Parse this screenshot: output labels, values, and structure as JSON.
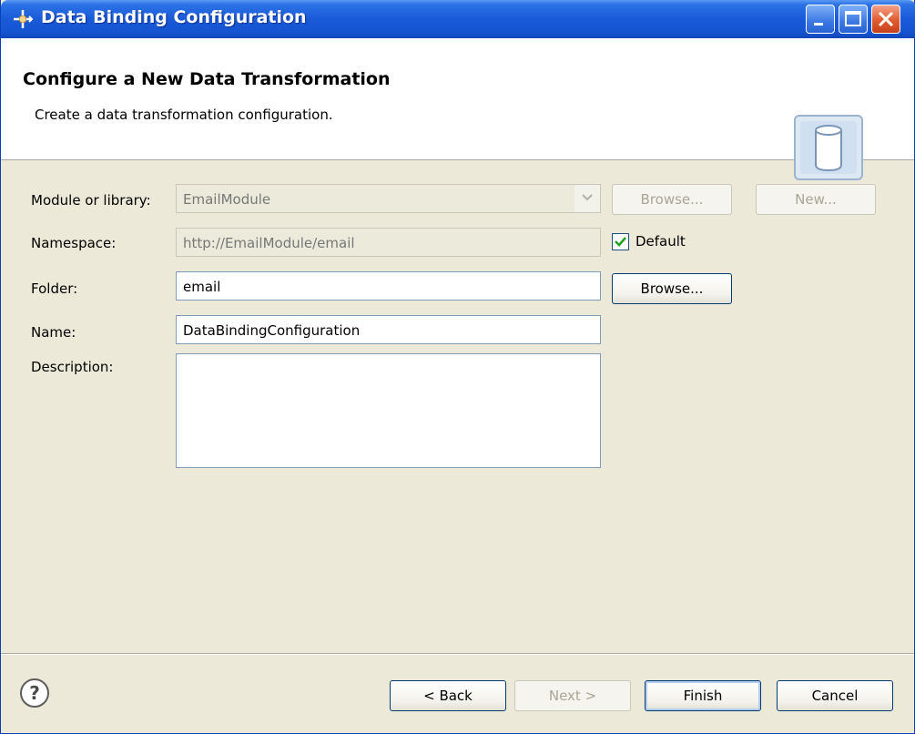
{
  "window": {
    "title": "Data Binding Configuration",
    "icons": {
      "app": "data-binding-icon",
      "minimize": "minimize-icon",
      "maximize": "maximize-icon",
      "close": "close-icon"
    }
  },
  "banner": {
    "title": "Configure a New Data Transformation",
    "subtitle": "Create a data transformation configuration.",
    "icon": "database-cylinder-icon"
  },
  "form": {
    "module": {
      "label": "Module or library:",
      "value": "EmailModule",
      "browse_label": "Browse...",
      "new_label": "New..."
    },
    "namespace": {
      "label": "Namespace:",
      "value": "http://EmailModule/email",
      "default_label": "Default",
      "default_checked": true
    },
    "folder": {
      "label": "Folder:",
      "value": "email",
      "browse_label": "Browse..."
    },
    "name": {
      "label": "Name:",
      "value": "DataBindingConfiguration"
    },
    "description": {
      "label": "Description:",
      "value": ""
    }
  },
  "footer": {
    "help_icon": "help-icon",
    "back_label": "< Back",
    "next_label": "Next >",
    "finish_label": "Finish",
    "cancel_label": "Cancel"
  }
}
